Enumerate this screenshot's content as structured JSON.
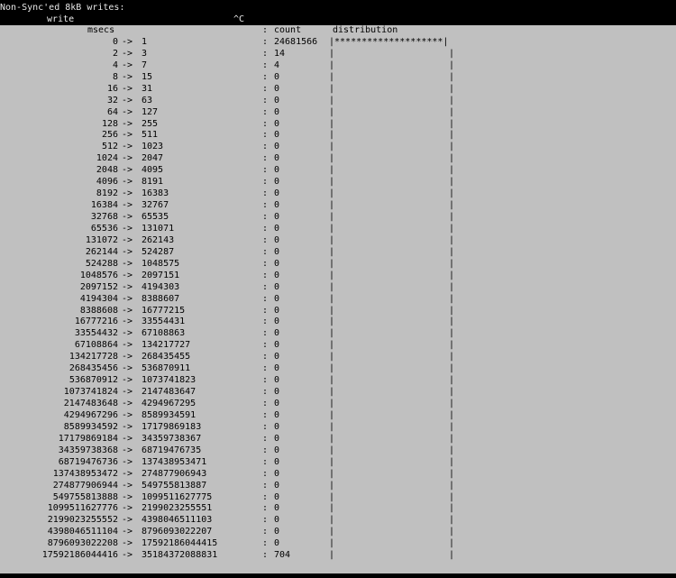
{
  "terminal": {
    "title_line": "Non-Sync'ed 8kB writes:",
    "subtitle_write": "write",
    "subtitle_ctrl": "^C"
  },
  "header": {
    "msecs": "msecs",
    "colon": ":",
    "count": "count",
    "distribution": "distribution"
  },
  "rows": [
    {
      "lo": "0",
      "hi": "1",
      "count": "24681566",
      "dist": "|********************|"
    },
    {
      "lo": "2",
      "hi": "3",
      "count": "14",
      "dist": "|"
    },
    {
      "lo": "4",
      "hi": "7",
      "count": "4",
      "dist": "|"
    },
    {
      "lo": "8",
      "hi": "15",
      "count": "0",
      "dist": "|"
    },
    {
      "lo": "16",
      "hi": "31",
      "count": "0",
      "dist": "|"
    },
    {
      "lo": "32",
      "hi": "63",
      "count": "0",
      "dist": "|"
    },
    {
      "lo": "64",
      "hi": "127",
      "count": "0",
      "dist": "|"
    },
    {
      "lo": "128",
      "hi": "255",
      "count": "0",
      "dist": "|"
    },
    {
      "lo": "256",
      "hi": "511",
      "count": "0",
      "dist": "|"
    },
    {
      "lo": "512",
      "hi": "1023",
      "count": "0",
      "dist": "|"
    },
    {
      "lo": "1024",
      "hi": "2047",
      "count": "0",
      "dist": "|"
    },
    {
      "lo": "2048",
      "hi": "4095",
      "count": "0",
      "dist": "|"
    },
    {
      "lo": "4096",
      "hi": "8191",
      "count": "0",
      "dist": "|"
    },
    {
      "lo": "8192",
      "hi": "16383",
      "count": "0",
      "dist": "|"
    },
    {
      "lo": "16384",
      "hi": "32767",
      "count": "0",
      "dist": "|"
    },
    {
      "lo": "32768",
      "hi": "65535",
      "count": "0",
      "dist": "|"
    },
    {
      "lo": "65536",
      "hi": "131071",
      "count": "0",
      "dist": "|"
    },
    {
      "lo": "131072",
      "hi": "262143",
      "count": "0",
      "dist": "|"
    },
    {
      "lo": "262144",
      "hi": "524287",
      "count": "0",
      "dist": "|"
    },
    {
      "lo": "524288",
      "hi": "1048575",
      "count": "0",
      "dist": "|"
    },
    {
      "lo": "1048576",
      "hi": "2097151",
      "count": "0",
      "dist": "|"
    },
    {
      "lo": "2097152",
      "hi": "4194303",
      "count": "0",
      "dist": "|"
    },
    {
      "lo": "4194304",
      "hi": "8388607",
      "count": "0",
      "dist": "|"
    },
    {
      "lo": "8388608",
      "hi": "16777215",
      "count": "0",
      "dist": "|"
    },
    {
      "lo": "16777216",
      "hi": "33554431",
      "count": "0",
      "dist": "|"
    },
    {
      "lo": "33554432",
      "hi": "67108863",
      "count": "0",
      "dist": "|"
    },
    {
      "lo": "67108864",
      "hi": "134217727",
      "count": "0",
      "dist": "|"
    },
    {
      "lo": "134217728",
      "hi": "268435455",
      "count": "0",
      "dist": "|"
    },
    {
      "lo": "268435456",
      "hi": "536870911",
      "count": "0",
      "dist": "|"
    },
    {
      "lo": "536870912",
      "hi": "1073741823",
      "count": "0",
      "dist": "|"
    },
    {
      "lo": "1073741824",
      "hi": "2147483647",
      "count": "0",
      "dist": "|"
    },
    {
      "lo": "2147483648",
      "hi": "4294967295",
      "count": "0",
      "dist": "|"
    },
    {
      "lo": "4294967296",
      "hi": "8589934591",
      "count": "0",
      "dist": "|"
    },
    {
      "lo": "8589934592",
      "hi": "17179869183",
      "count": "0",
      "dist": "|"
    },
    {
      "lo": "17179869184",
      "hi": "34359738367",
      "count": "0",
      "dist": "|"
    },
    {
      "lo": "34359738368",
      "hi": "68719476735",
      "count": "0",
      "dist": "|"
    },
    {
      "lo": "68719476736",
      "hi": "137438953471",
      "count": "0",
      "dist": "|"
    },
    {
      "lo": "137438953472",
      "hi": "274877906943",
      "count": "0",
      "dist": "|"
    },
    {
      "lo": "274877906944",
      "hi": "549755813887",
      "count": "0",
      "dist": "|"
    },
    {
      "lo": "549755813888",
      "hi": "1099511627775",
      "count": "0",
      "dist": "|"
    },
    {
      "lo": "1099511627776",
      "hi": "2199023255551",
      "count": "0",
      "dist": "|"
    },
    {
      "lo": "2199023255552",
      "hi": "4398046511103",
      "count": "0",
      "dist": "|"
    },
    {
      "lo": "4398046511104",
      "hi": "8796093022207",
      "count": "0",
      "dist": "|"
    },
    {
      "lo": "8796093022208",
      "hi": "17592186044415",
      "count": "0",
      "dist": "|"
    },
    {
      "lo": "17592186044416",
      "hi": "35184372088831",
      "count": "704",
      "dist": "|"
    }
  ]
}
